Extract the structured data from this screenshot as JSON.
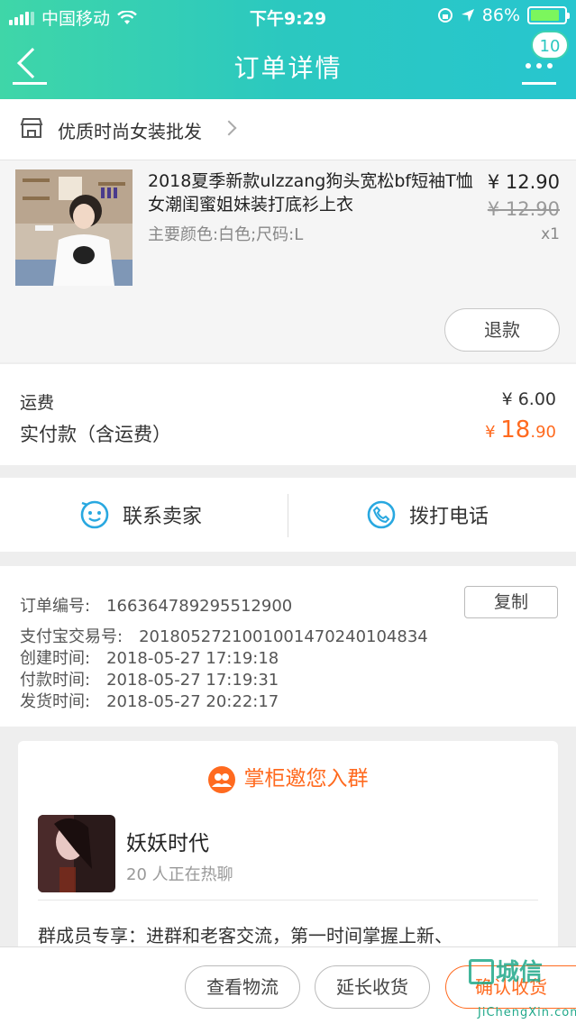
{
  "status_bar": {
    "carrier": "中国移动",
    "time": "下午9:29",
    "battery": "86%",
    "battery_level": 0.86
  },
  "header": {
    "title": "订单详情",
    "badge_count": "10"
  },
  "shop": {
    "name": "优质时尚女装批发"
  },
  "product": {
    "title": "2018夏季新款ulzzang狗头宽松bf短袖T恤女潮闺蜜姐妹装打底衫上衣",
    "attributes": "主要颜色:白色;尺码:L",
    "price": "¥ 12.90",
    "original_price": "¥ 12.90",
    "quantity": "x1",
    "refund_label": "退款"
  },
  "fees": {
    "shipping_label": "运费",
    "shipping_value": "¥ 6.00",
    "paid_label": "实付款（含运费）",
    "paid_currency": "¥ ",
    "paid_int": "18",
    "paid_dec": ".90"
  },
  "contact": {
    "seller_label": "联系卖家",
    "phone_label": "拨打电话"
  },
  "order_info": {
    "order_no_label": "订单编号:",
    "order_no": "166364789295512900",
    "copy_label": "复制",
    "alipay_label": "支付宝交易号:",
    "alipay_no": "2018052721001001470240104834",
    "created_label": "创建时间:",
    "created": "2018-05-27 17:19:18",
    "paid_time_label": "付款时间:",
    "paid_time": "2018-05-27 17:19:31",
    "shipped_label": "发货时间:",
    "shipped": "2018-05-27 20:22:17"
  },
  "group": {
    "heading": "掌柜邀您入群",
    "name": "妖妖时代",
    "members": "20 人正在热聊",
    "description": "群成员专享：进群和老客交流，第一时间掌握上新、"
  },
  "bottom_bar": {
    "logistics": "查看物流",
    "extend": "延长收货",
    "confirm": "确认收货"
  },
  "watermark": {
    "text": "城信",
    "sub": "JiChengXin.com"
  }
}
